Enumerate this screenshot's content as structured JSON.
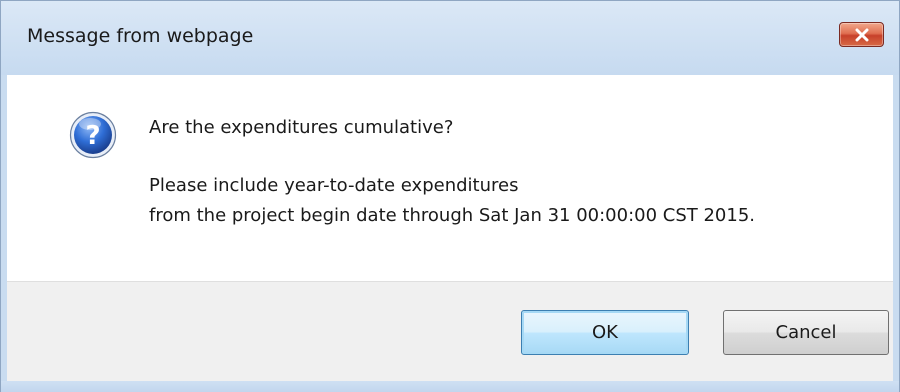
{
  "dialog": {
    "title": "Message from webpage",
    "close_icon": "close-icon",
    "icon": "question-icon",
    "question": "Are the expenditures cumulative?",
    "detail_line1": "Please include year-to-date expenditures",
    "detail_line2": "from the project begin date through Sat Jan 31 00:00:00 CST 2015."
  },
  "buttons": {
    "ok_label": "OK",
    "cancel_label": "Cancel"
  },
  "colors": {
    "titlebar": "#c6daf0",
    "close_button": "#c7402a",
    "ok_highlight": "#3c7fb1",
    "question_icon": "#2a62c7"
  }
}
